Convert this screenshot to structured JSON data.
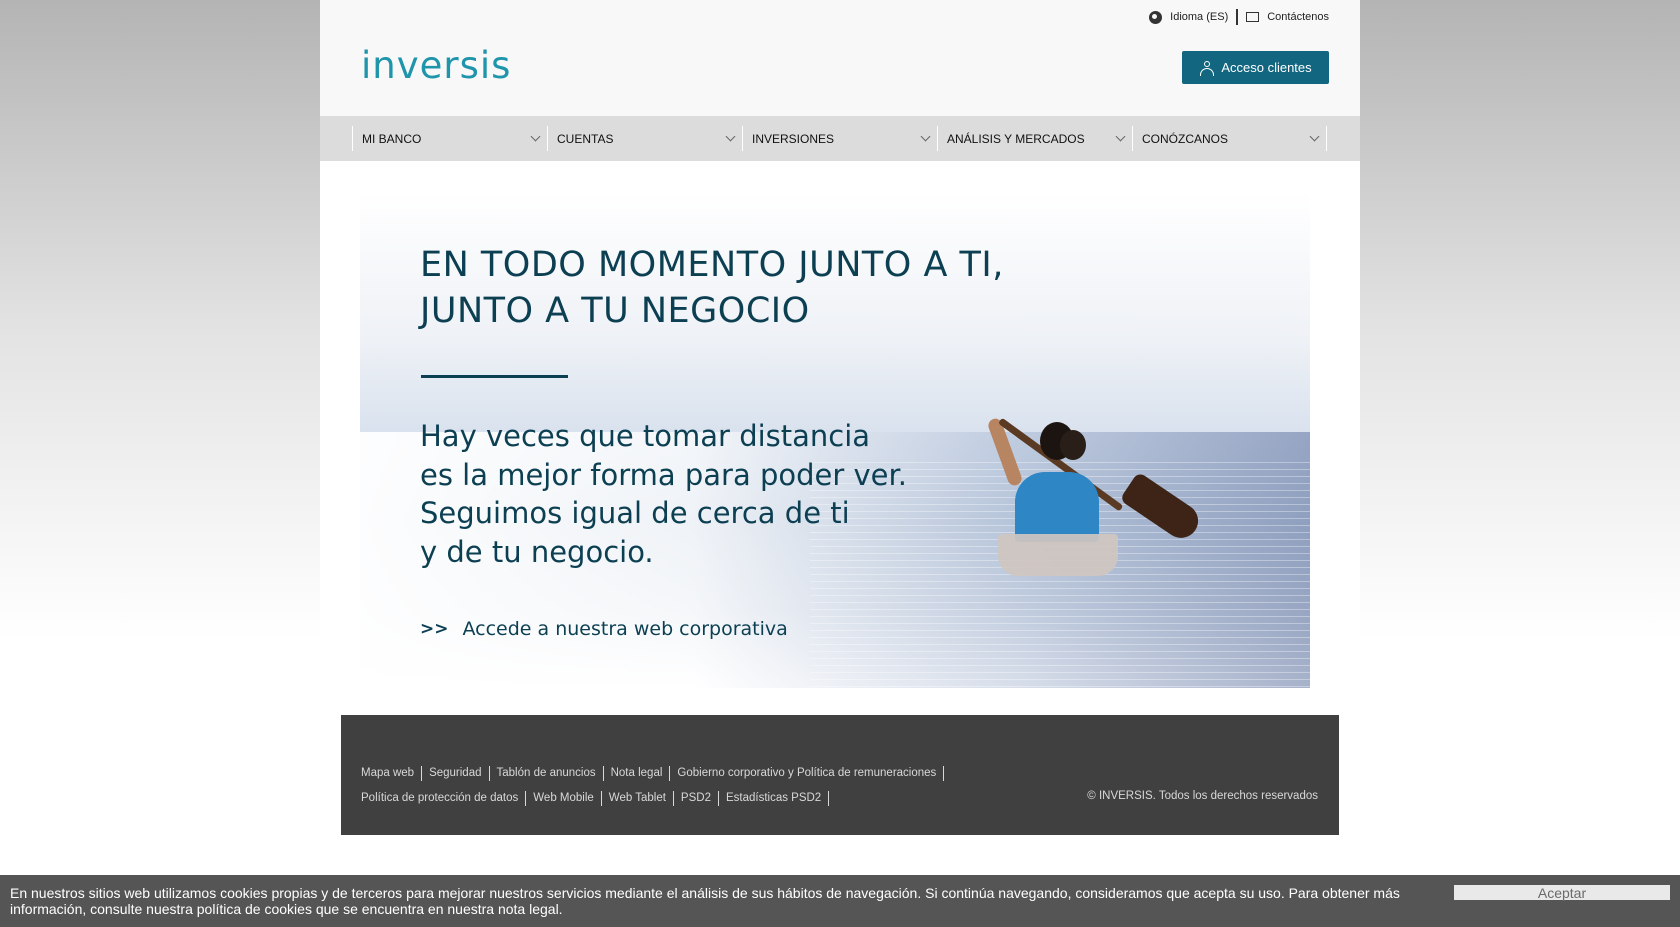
{
  "header": {
    "language_label": "Idioma (ES)",
    "contact_label": "Contáctenos",
    "logo_text": "inversis",
    "access_button_label": "Acceso clientes"
  },
  "nav": {
    "items": [
      {
        "label": "MI BANCO"
      },
      {
        "label": "CUENTAS"
      },
      {
        "label": "INVERSIONES"
      },
      {
        "label": "ANÁLISIS Y MERCADOS"
      },
      {
        "label": "CONÓZCANOS"
      }
    ]
  },
  "hero": {
    "title_line1": "EN TODO MOMENTO JUNTO A TI,",
    "title_line2": "JUNTO A TU NEGOCIO",
    "text_line1": "Hay veces que tomar distancia",
    "text_line2": "es la mejor forma para poder ver.",
    "text_line3": "Seguimos igual de cerca de ti",
    "text_line4": "y de tu negocio.",
    "link_arrows": ">>",
    "link_label": "Accede a nuestra web corporativa"
  },
  "footer": {
    "row1": [
      "Mapa web",
      "Seguridad",
      "Tablón de anuncios",
      "Nota legal",
      "Gobierno corporativo y Política de remuneraciones"
    ],
    "row2": [
      "Política de protección de datos",
      "Web Mobile",
      "Web Tablet",
      "PSD2",
      "Estadísticas PSD2"
    ],
    "copyright": "© INVERSIS. Todos los derechos reservados"
  },
  "cookie": {
    "text": "En nuestros sitios web utilizamos cookies propias y de terceros para mejorar nuestros servicios mediante el análisis de sus hábitos de navegación. Si continúa navegando, consideramos que acepta su uso. Para obtener más información, consulte nuestra política de cookies que se encuentra en nuestra nota legal.",
    "accept_label": "Aceptar"
  },
  "colors": {
    "brand_teal": "#1e95ab",
    "button_blue": "#126680",
    "hero_text": "#0c3f52",
    "footer_bg": "#404040",
    "cookie_bg": "#555555"
  }
}
